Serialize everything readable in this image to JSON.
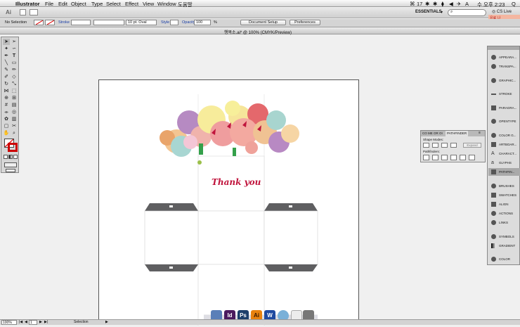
{
  "menubar": {
    "apple": "",
    "app_name": "Illustrator",
    "items": [
      "File",
      "Edit",
      "Object",
      "Type",
      "Select",
      "Effect",
      "View",
      "Window",
      "도움말"
    ],
    "status_icons": [
      "⌘",
      "17",
      "✱",
      "✱",
      "⧫",
      "◀",
      "✈",
      "A"
    ],
    "clock": "수 오후 2:23",
    "cs_search": "Q"
  },
  "appbar": {
    "logo": "Ai",
    "workspace": "ESSENTIALS",
    "search_placeholder": "",
    "cs_live": "CS Live",
    "notice": "유료 나"
  },
  "control": {
    "selection": "No Selection",
    "stroke_label": "Stroke",
    "brush_value": "10 pt. Oval",
    "style_label": "Style",
    "opacity_label": "Opacity",
    "opacity_value": "100",
    "opacity_unit": "%",
    "doc_setup": "Document Setup",
    "preferences": "Preferences"
  },
  "document": {
    "tab_title": "행복소.ai* @ 100% (CMYK/Preview)",
    "thank_you": "Thank you"
  },
  "right_panel": {
    "items": [
      "APPEARA...",
      "TRANSPA...",
      "GRAPHIC...",
      "STROKE",
      "PARAGRA...",
      "OPENTYPE",
      "COLOR G...",
      "ARTBOAR...",
      "CHARACT...",
      "GLYPHS",
      "PATHFIN...",
      "BRUSHES",
      "SWATCHES",
      "ALIGN",
      "ACTIONS",
      "LINKS",
      "SYMBOLS",
      "GRADIENT",
      "COLOR"
    ]
  },
  "pathfinder": {
    "tabs": [
      "CO",
      "ME",
      "OR",
      "OI",
      "PATHFINDER"
    ],
    "shape_modes": "Shape Modes:",
    "pathfinders": "Pathfinders:",
    "expand": "Expand"
  },
  "status": {
    "zoom": "100%",
    "page": "1",
    "tool": "Selection"
  },
  "dock": {
    "items": [
      {
        "label": "",
        "color": "#5a7fb8"
      },
      {
        "label": "Id",
        "color": "#4b1a5e"
      },
      {
        "label": "Ps",
        "color": "#1c3f6b"
      },
      {
        "label": "Ai",
        "color": "#e8820e"
      },
      {
        "label": "W",
        "color": "#1f4aa0"
      },
      {
        "label": "",
        "color": "#7ab0d8"
      },
      {
        "label": "",
        "color": "#ececec"
      },
      {
        "label": "",
        "color": "#777"
      }
    ]
  },
  "colors": {
    "accent_select": "#3a6fb5",
    "band_gray": "#5f5f61",
    "thank_red": "#c0143c"
  }
}
